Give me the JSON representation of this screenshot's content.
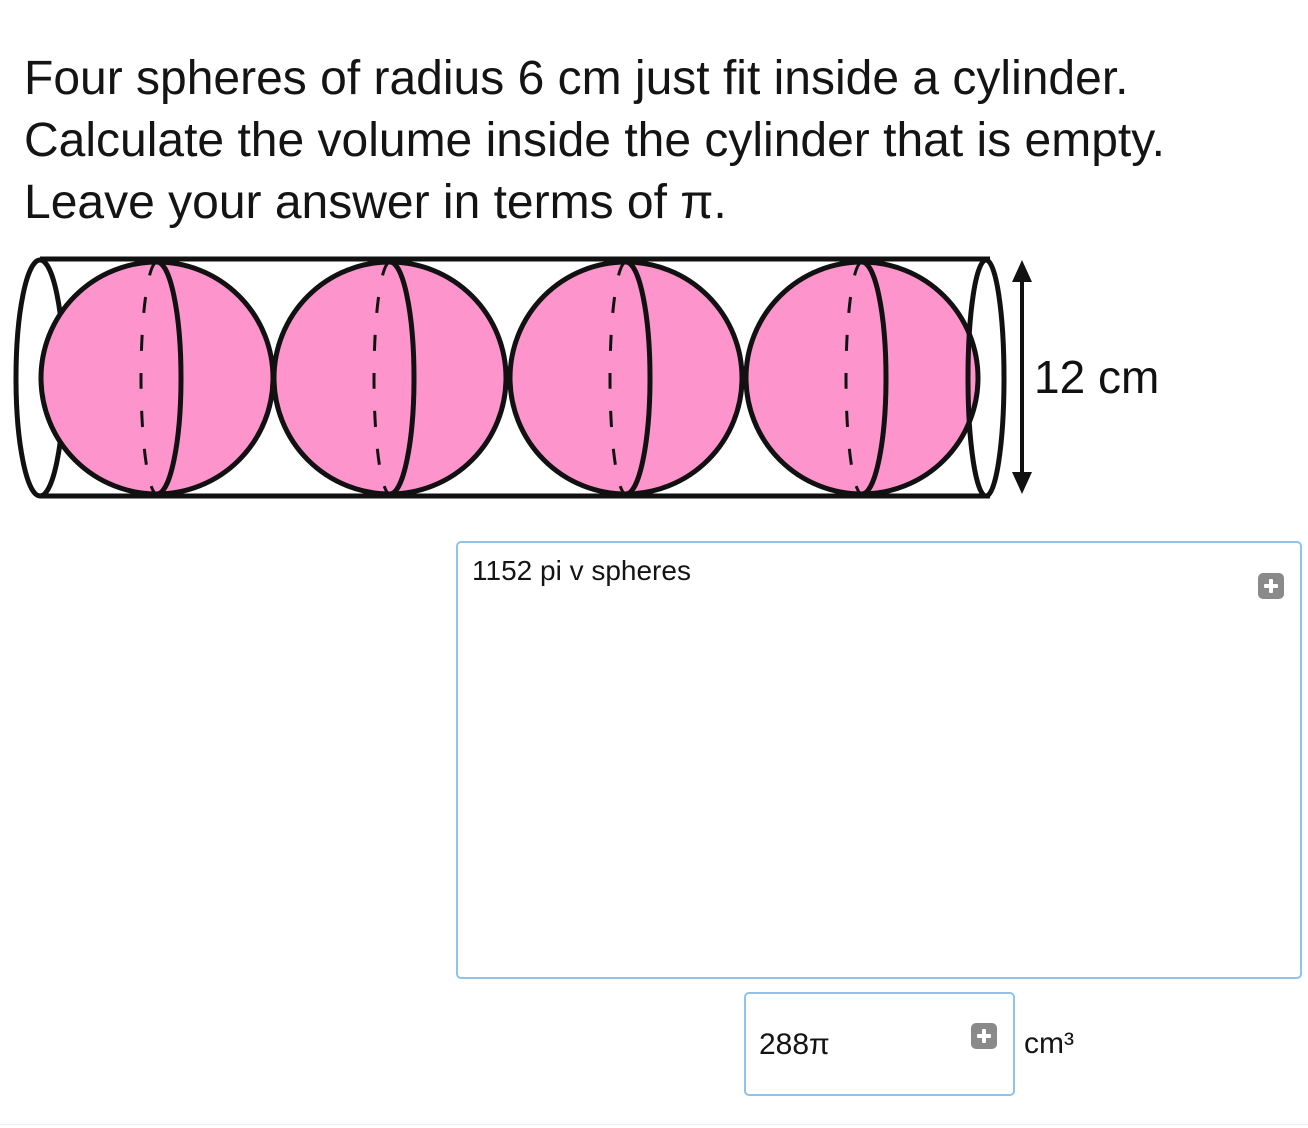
{
  "question": {
    "line1": "Four spheres of radius 6 cm just fit inside a cylinder.",
    "line2": "Calculate the volume inside the cylinder that is empty.",
    "line3": "Leave your answer in terms of π."
  },
  "diagram": {
    "sphere_count": 4,
    "height_label": "12 cm",
    "sphere_fill": "#fd94cb",
    "outline_color": "#111111"
  },
  "working": {
    "text": "1152 pi v spheres",
    "add_icon": "plus-square-icon"
  },
  "answer": {
    "value": "288π",
    "unit": "cm³",
    "add_icon": "plus-square-icon"
  },
  "colors": {
    "input_border": "#8fc3ea",
    "plus_button": "#8a8a8a"
  }
}
